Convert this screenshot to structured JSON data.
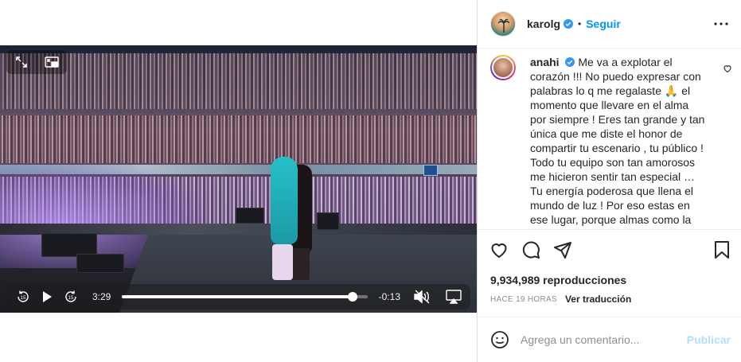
{
  "video": {
    "current_time": "3:29",
    "remaining_time": "-0:13",
    "progress": 0.94,
    "seek_back_label": "15",
    "seek_forward_label": "15"
  },
  "header": {
    "username": "karolg",
    "separator": "•",
    "follow_label": "Seguir"
  },
  "comment": {
    "username": "anahi",
    "text": "Me va a explotar el corazón !!! No puedo expresar con palabras lo q me regalaste 🙏 el momento que llevare en el alma por siempre ! Eres tan grande y tan única que me diste el honor de compartir tu escenario , tu público ! Todo tu equipo son tan amorosos me hicieron sentir tan especial … Tu energía poderosa que llena el mundo de luz ! Por eso estas en ese lugar, porque almas como la"
  },
  "stats": {
    "views": "9,934,989 reproducciones",
    "time_ago": "HACE 19 HORAS",
    "translate_label": "Ver traducción"
  },
  "composer": {
    "placeholder": "Agrega un comentario...",
    "publish_label": "Publicar"
  },
  "colors": {
    "link_blue": "#0095f6",
    "publish_disabled": "#b2dffc",
    "verified_blue": "#3897f0"
  }
}
